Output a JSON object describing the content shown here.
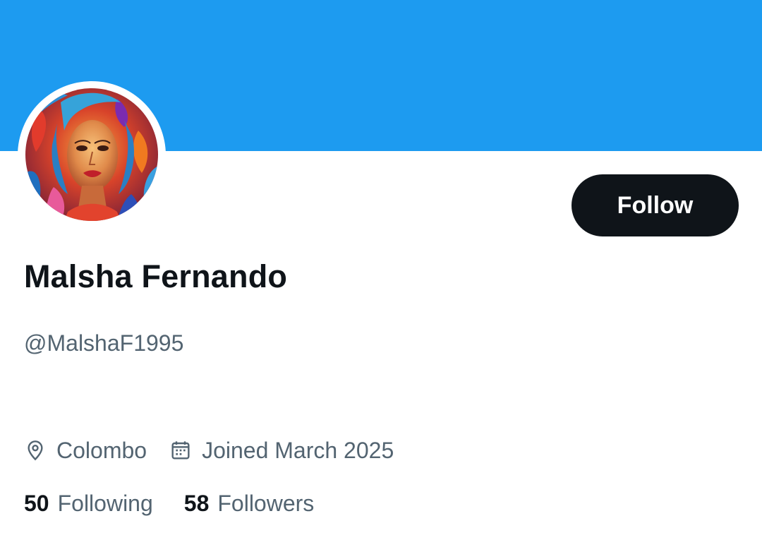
{
  "profile": {
    "display_name": "Malsha Fernando",
    "handle": "@MalshaF1995",
    "location": "Colombo",
    "joined": "Joined March 2025",
    "follow_label": "Follow"
  },
  "stats": {
    "following_count": "50",
    "following_label": "Following",
    "followers_count": "58",
    "followers_label": "Followers"
  },
  "icons": {
    "location": "location-pin-icon",
    "joined": "calendar-icon"
  },
  "colors": {
    "banner": "#1d9bf0",
    "follow_button_bg": "#0f1419",
    "primary_text": "#0f1419",
    "secondary_text": "#536471"
  }
}
